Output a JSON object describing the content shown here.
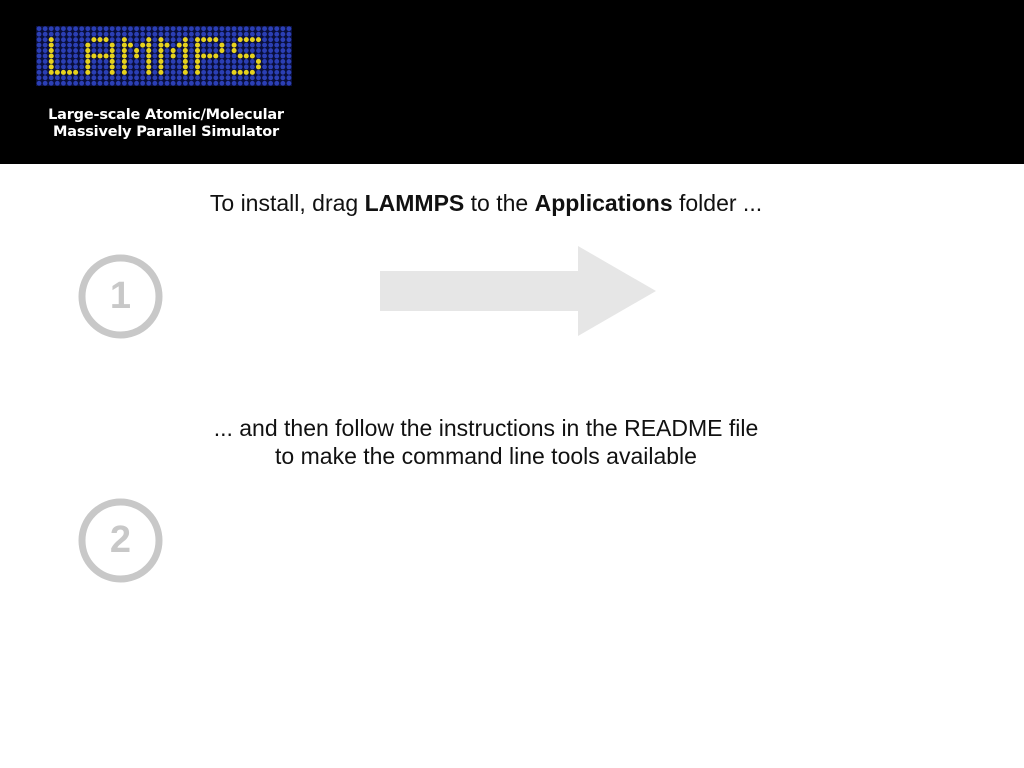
{
  "header": {
    "logo_alt": "LAMMPS",
    "tagline_line1": "Large-scale Atomic/Molecular",
    "tagline_line2": "Massively Parallel Simulator"
  },
  "steps": [
    {
      "number": "1",
      "text_parts": [
        "To install, drag ",
        "LAMMPS",
        " to the ",
        "Applications",
        " folder ..."
      ]
    },
    {
      "number": "2",
      "line1": "... and then follow the instructions in the README file",
      "line2": "to make the command line tools available"
    }
  ],
  "colors": {
    "banner_bg": "#000000",
    "logo_yellow": "#e6d21e",
    "logo_blue": "#2b3fb5",
    "badge_gray": "#c8c8c8",
    "arrow_gray": "#e6e6e6"
  },
  "icons": {
    "arrow": "right-arrow-icon",
    "badge": "numbered-circle-icon"
  }
}
